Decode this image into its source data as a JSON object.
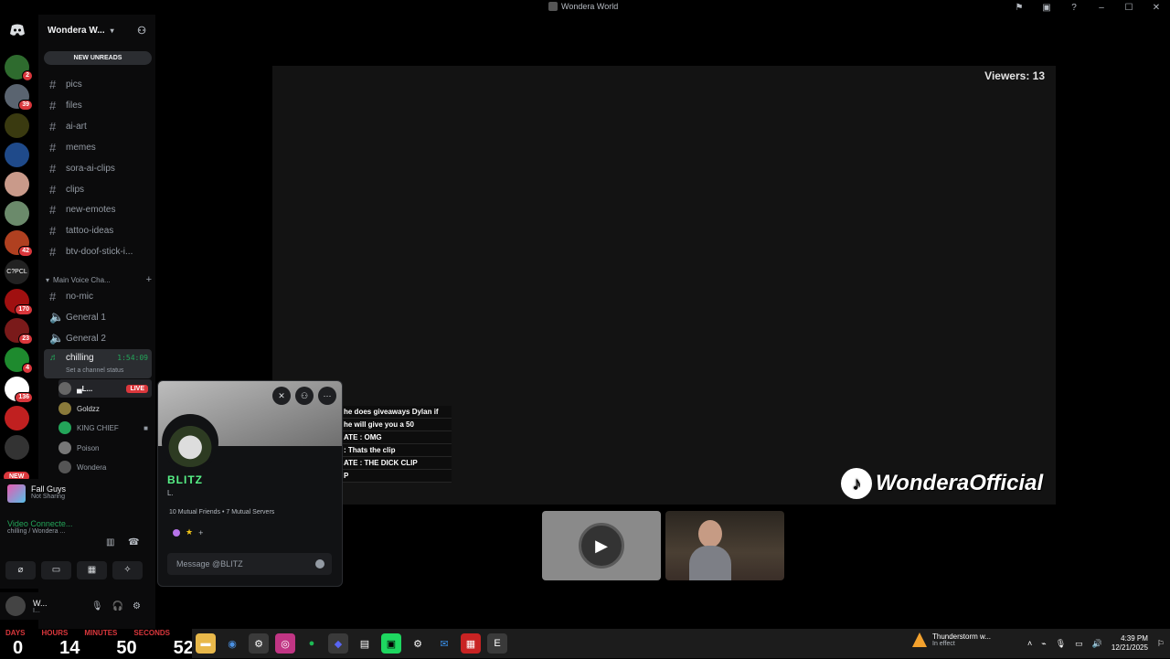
{
  "window": {
    "title": "Wondera World"
  },
  "server": {
    "name": "Wondera W...",
    "new_unreads": "NEW UNREADS"
  },
  "guild_badges": [
    "2",
    "39",
    "",
    "",
    "",
    "",
    "",
    "42",
    "",
    "170",
    "23",
    "4",
    "136",
    "",
    ""
  ],
  "guild_new": "NEW",
  "channels": [
    {
      "name": "pics"
    },
    {
      "name": "files"
    },
    {
      "name": "ai-art"
    },
    {
      "name": "memes"
    },
    {
      "name": "sora-ai-clips"
    },
    {
      "name": "clips"
    },
    {
      "name": "new-emotes"
    },
    {
      "name": "tattoo-ideas"
    },
    {
      "name": "btv-doof-stick-i..."
    }
  ],
  "category": {
    "label": "Main Voice Cha..."
  },
  "voice_channels": [
    {
      "name": "no-mic",
      "type": "text"
    },
    {
      "name": "General 1",
      "type": "voice"
    },
    {
      "name": "General 2",
      "type": "voice"
    }
  ],
  "active_voice": {
    "name": "chilling",
    "time": "1:54:09",
    "status": "Set a channel status"
  },
  "voice_users": [
    {
      "name": "▄L...",
      "live": "LIVE"
    },
    {
      "name": "Goldzz"
    },
    {
      "name": "KING CHIEF"
    },
    {
      "name": "Poison"
    },
    {
      "name": "Wondera"
    }
  ],
  "activity": {
    "game": "Fall Guys",
    "status": "Not Sharing"
  },
  "connection": {
    "title": "Video Connecte...",
    "sub": "chilling / Wondera ..."
  },
  "userbar": {
    "name": "W...",
    "sub": "I..."
  },
  "stage": {
    "viewers": "Viewers: 13",
    "chat": [
      "he does giveaways Dylan if",
      "he will give you a 50",
      "ATE : OMG",
      ": Thats the clip",
      "ATE : THE DICK CLIP",
      "P"
    ],
    "watermark": "WonderaOfficial"
  },
  "popout": {
    "name": "BLITZ",
    "sub": "L.",
    "mutual": "10 Mutual Friends • 7 Mutual Servers",
    "message_placeholder": "Message @BLITZ"
  },
  "timer": {
    "labels": [
      "DAYS",
      "HOURS",
      "MINUTES",
      "SECONDS"
    ],
    "values": [
      "0",
      "14",
      "50",
      "52"
    ]
  },
  "weather": {
    "title": "Thunderstorm w...",
    "sub": "In effect"
  },
  "clock": {
    "time": "4:39 PM",
    "date": "12/21/2025"
  }
}
